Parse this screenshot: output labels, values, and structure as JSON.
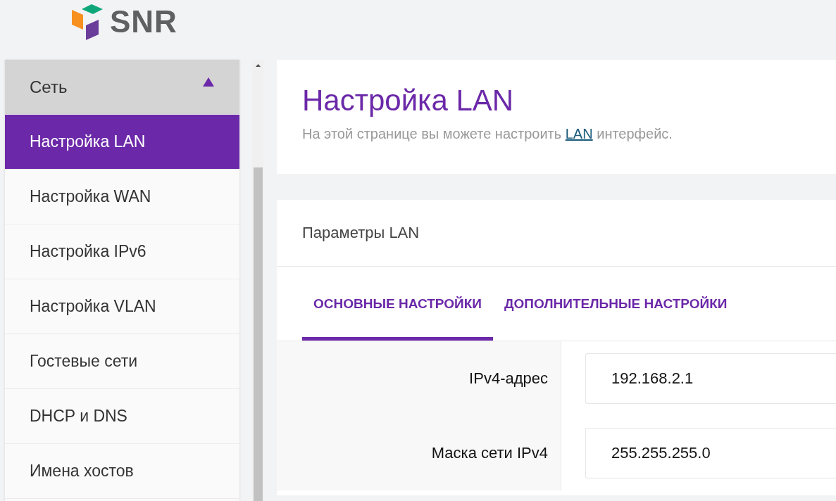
{
  "logo": {
    "text": "SNR"
  },
  "sidebar": {
    "group": {
      "label": "Сеть",
      "expanded": true
    },
    "items": [
      {
        "label": "Настройка LAN",
        "selected": true
      },
      {
        "label": "Настройка WAN",
        "selected": false
      },
      {
        "label": "Настройка IPv6",
        "selected": false
      },
      {
        "label": "Настройка VLAN",
        "selected": false
      },
      {
        "label": "Гостевые сети",
        "selected": false
      },
      {
        "label": "DHCP и DNS",
        "selected": false
      },
      {
        "label": "Имена хостов",
        "selected": false
      }
    ]
  },
  "page": {
    "title": "Настройка LAN",
    "description": {
      "before": "На этой странице вы можете настроить ",
      "link": "LAN",
      "after": " интерфейс."
    }
  },
  "card": {
    "title": "Параметры LAN",
    "tabs": [
      {
        "label": "ОСНОВНЫЕ НАСТРОЙКИ",
        "selected": true
      },
      {
        "label": "ДОПОЛНИТЕЛЬНЫЕ НАСТРОЙКИ",
        "selected": false
      }
    ],
    "fields": [
      {
        "label": "IPv4-адрес",
        "value": "192.168.2.1"
      },
      {
        "label": "Маска сети IPv4",
        "value": "255.255.255.0"
      }
    ]
  }
}
